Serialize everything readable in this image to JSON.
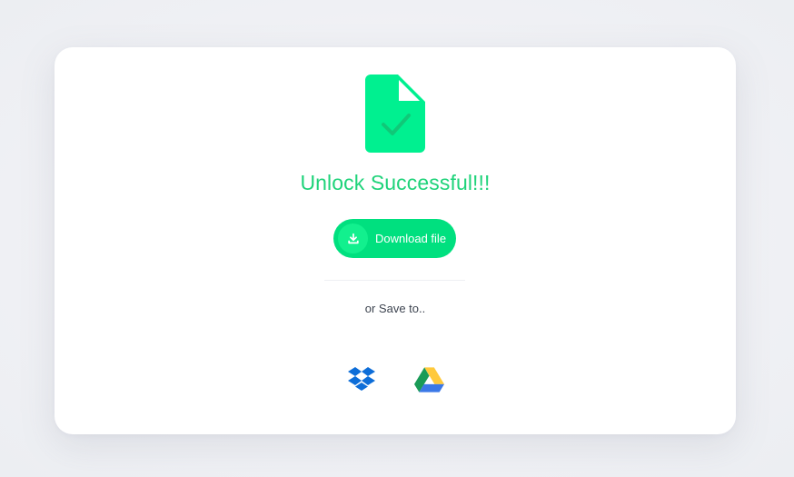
{
  "result": {
    "title": "Unlock Successful!!!",
    "icon": "file-check-icon"
  },
  "download": {
    "label": "Download file",
    "icon": "download-icon"
  },
  "save_to": {
    "label": "or Save to..",
    "providers": [
      {
        "name": "Dropbox",
        "icon": "dropbox-icon"
      },
      {
        "name": "Google Drive",
        "icon": "google-drive-icon"
      }
    ]
  },
  "colors": {
    "accent": "#00e07f",
    "title": "#1fd37a",
    "icon_fill": "#00f090",
    "dropbox": "#0d6dd8"
  }
}
